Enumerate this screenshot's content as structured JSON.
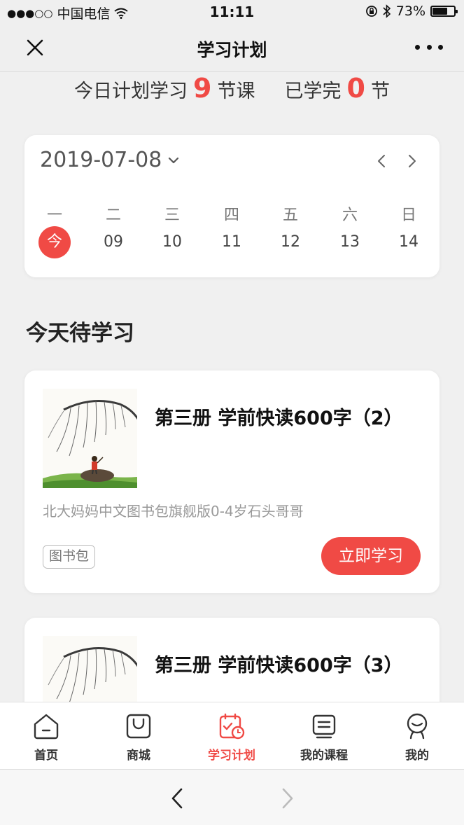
{
  "status_bar": {
    "carrier": "中国电信",
    "time": "11:11",
    "battery_percent": "73%",
    "battery_level": 0.73
  },
  "nav": {
    "title": "学习计划"
  },
  "summary": {
    "prefix": "今日计划学习",
    "planned_count": "9",
    "planned_unit": "节课",
    "done_prefix": "已学完",
    "done_count": "0",
    "done_unit": "节"
  },
  "calendar": {
    "date": "2019-07-08",
    "weekdays": [
      "一",
      "二",
      "三",
      "四",
      "五",
      "六",
      "日"
    ],
    "days": [
      "今",
      "09",
      "10",
      "11",
      "12",
      "13",
      "14"
    ],
    "today_index": 0,
    "accent_color": "#f04a45"
  },
  "section": {
    "title": "今天待学习"
  },
  "courses": [
    {
      "title": "第三册 学前快读600字（2）",
      "subtitle": "北大妈妈中文图书包旗舰版0-4岁石头哥哥",
      "tag": "图书包",
      "button": "立即学习"
    },
    {
      "title": "第三册 学前快读600字（3）"
    }
  ],
  "tabbar": {
    "items": [
      {
        "label": "首页",
        "icon": "home-icon"
      },
      {
        "label": "商城",
        "icon": "shopping-bag-icon"
      },
      {
        "label": "学习计划",
        "icon": "study-plan-icon"
      },
      {
        "label": "我的课程",
        "icon": "course-list-icon"
      },
      {
        "label": "我的",
        "icon": "profile-icon"
      }
    ],
    "active_index": 2
  }
}
